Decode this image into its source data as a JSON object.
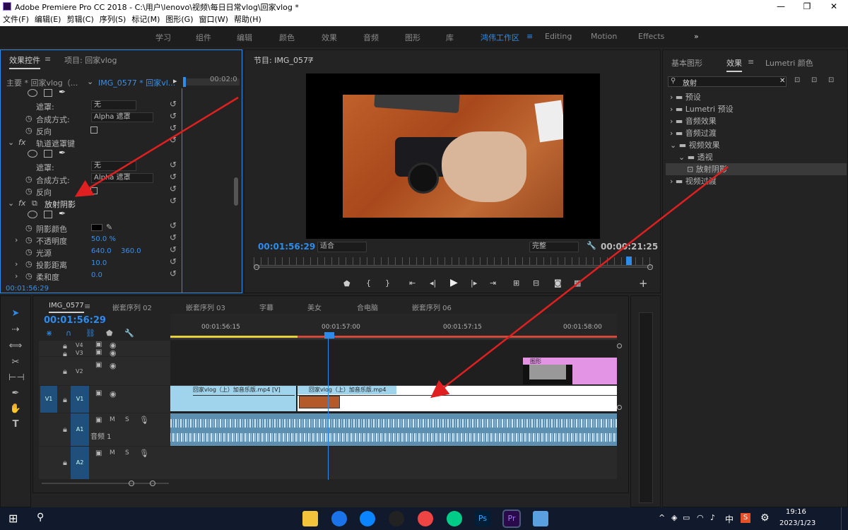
{
  "window": {
    "title": "Adobe Premiere Pro CC 2018 - C:\\用户\\lenovo\\视频\\每日日常vlog\\回家vlog *"
  },
  "menu": [
    "文件(F)",
    "编辑(E)",
    "剪辑(C)",
    "序列(S)",
    "标记(M)",
    "图形(G)",
    "窗口(W)",
    "帮助(H)"
  ],
  "workspaces": [
    "学习",
    "组件",
    "编辑",
    "颜色",
    "效果",
    "音频",
    "图形",
    "库",
    "鸿伟工作区",
    "Editing",
    "Motion",
    "Effects"
  ],
  "active_workspace": "鸿伟工作区",
  "effect_controls": {
    "tab_label": "效果控件",
    "project_tab": "项目: 回家vlog",
    "master": "主要 * 回家vlog（...",
    "clip": "IMG_0577 * 回家vl...",
    "tc_small": "00:02:0",
    "mask_label": "遮罩:",
    "mask_none": "无",
    "composite_label": "合成方式:",
    "composite_value": "Alpha 遮罩",
    "reverse_label": "反向",
    "track_matte": "轨道遮罩键",
    "radial": "放射阴影",
    "shadow_color": "阴影颜色",
    "opacity": "不透明度",
    "opacity_value": "50.0 %",
    "light_source": "光源",
    "light_x": "640.0",
    "light_y": "360.0",
    "distance": "投影距离",
    "distance_value": "10.0",
    "softness": "柔和度",
    "softness_value": "0.0",
    "timecode": "00:01:56:29"
  },
  "program": {
    "title": "节目: IMG_0577",
    "timecode": "00:01:56:29",
    "fit": "适合",
    "quality": "完整",
    "duration": "00:00:21:25",
    "progress": 0.94
  },
  "effects_panel": {
    "tabs": [
      "基本图形",
      "效果",
      "Lumetri 颜色"
    ],
    "active": "效果",
    "search": "放射",
    "tree": [
      "预设",
      "Lumetri 预设",
      "音频效果",
      "音频过渡",
      "视频效果",
      "透视",
      "放射阴影",
      "视频过渡"
    ]
  },
  "timeline": {
    "tabs": [
      "IMG_0577",
      "嵌套序列 02",
      "嵌套序列 03",
      "字幕",
      "美女",
      "合电脑",
      "嵌套序列 06"
    ],
    "timecode": "00:01:56:29",
    "ruler": [
      "00:01:56:15",
      "00:01:57:00",
      "00:01:57:15",
      "00:01:58:00"
    ],
    "tracks": {
      "v4": "V4",
      "v3": "V3",
      "v2": "V2",
      "v1": "V1",
      "a1": "A1",
      "a2": "A2",
      "audio_name": "音频 1",
      "m": "M",
      "s": "S"
    },
    "clip1": "回家vlog（上）加音乐版.mp4 [V]",
    "clip2": "回家vlog（上）加音乐版.mp4",
    "graphic_clip": "图形"
  },
  "taskbar": {
    "time": "19:16",
    "date": "2023/1/23",
    "ime": "中"
  }
}
